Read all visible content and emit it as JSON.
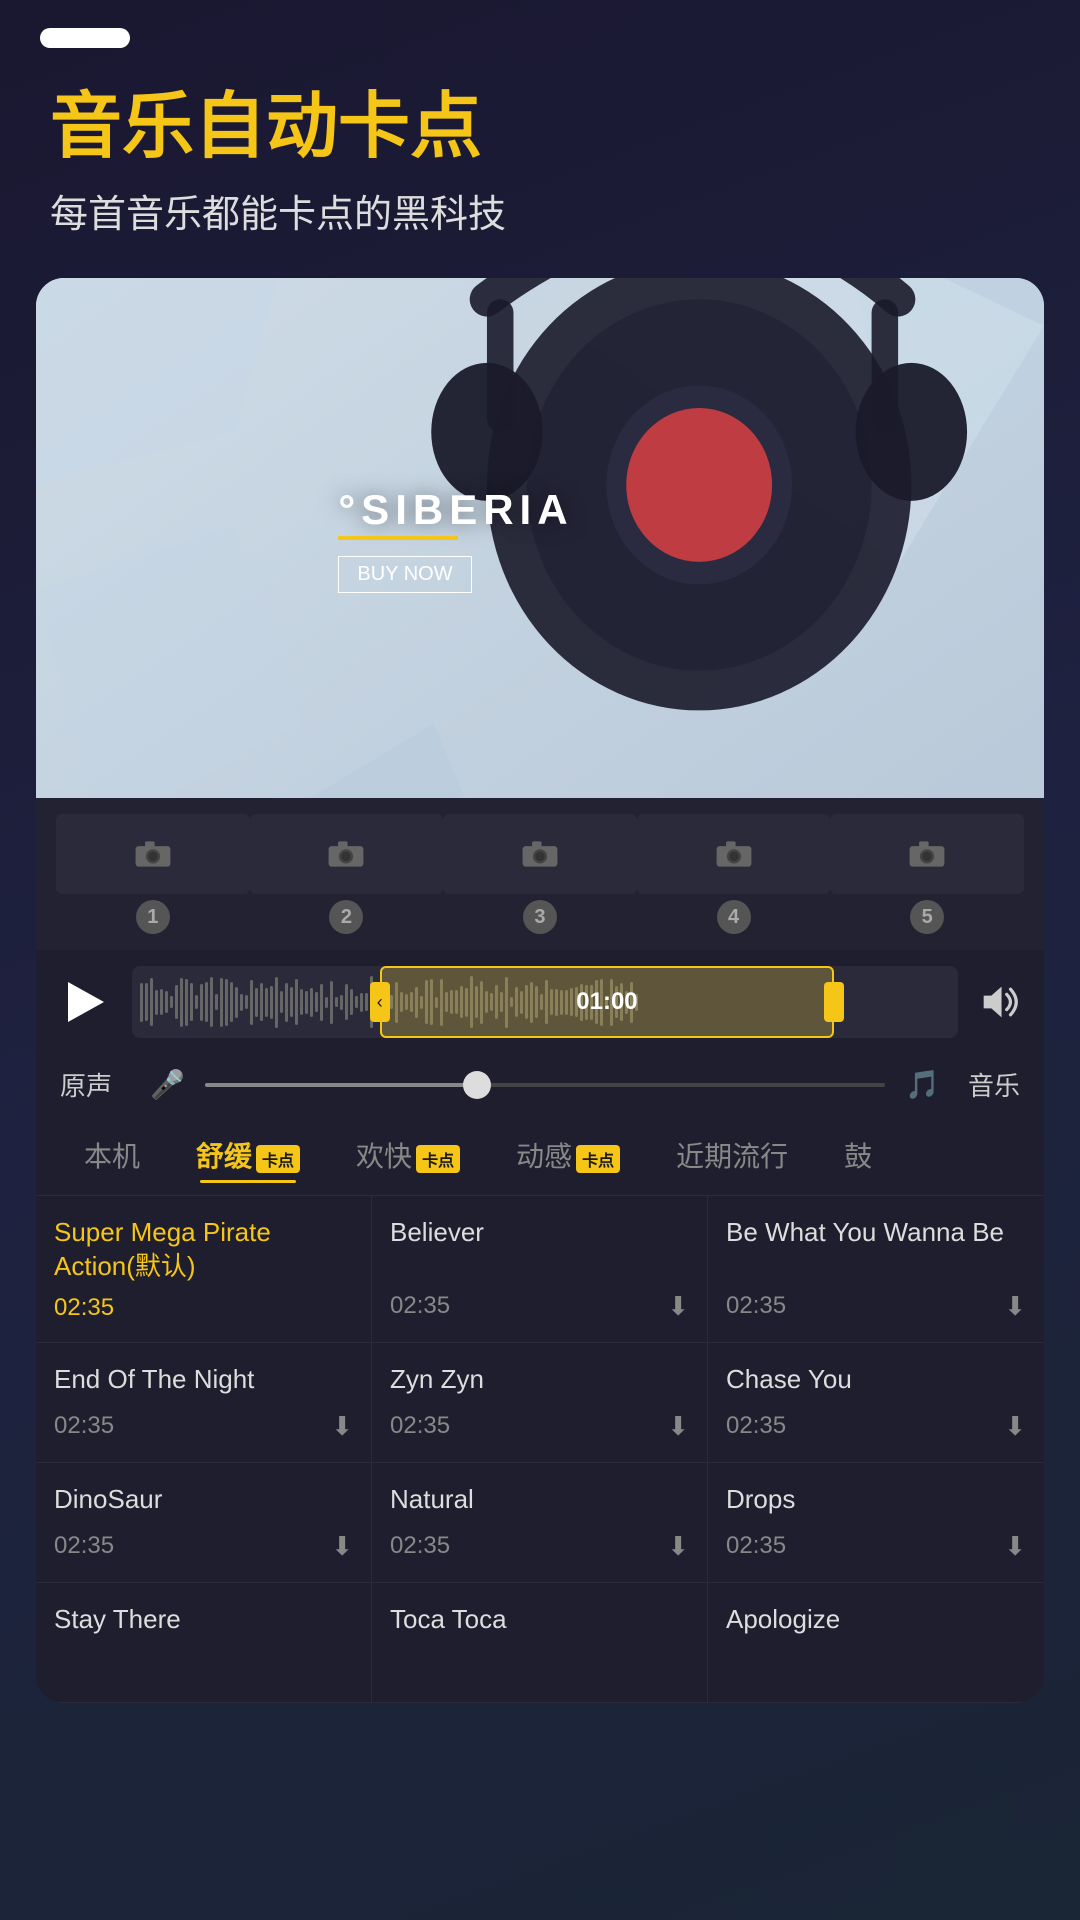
{
  "statusBar": {
    "pill": ""
  },
  "header": {
    "title": "音乐自动卡点",
    "subtitle": "每首音乐都能卡点的黑科技"
  },
  "videoPreview": {
    "brand": "°SIBERIA",
    "buyNow": "BUY NOW"
  },
  "waveform": {
    "time": "01:00"
  },
  "vocalSlider": {
    "leftLabel": "原声",
    "rightLabel": "音乐"
  },
  "tabs": [
    {
      "label": "本机",
      "badge": false,
      "active": false
    },
    {
      "label": "舒缓",
      "badge": true,
      "badgeText": "卡点",
      "active": true
    },
    {
      "label": "欢快",
      "badge": true,
      "badgeText": "卡点",
      "active": false
    },
    {
      "label": "动感",
      "badge": true,
      "badgeText": "卡点",
      "active": false
    },
    {
      "label": "近期流行",
      "badge": false,
      "active": false
    },
    {
      "label": "鼓",
      "badge": false,
      "active": false
    }
  ],
  "songs": [
    {
      "name": "Super Mega Pirate Action(默认)",
      "time": "02:35",
      "highlight": true,
      "download": false
    },
    {
      "name": "Believer",
      "time": "02:35",
      "highlight": false,
      "download": true
    },
    {
      "name": "Be What You Wanna Be",
      "time": "02:35",
      "highlight": false,
      "download": true
    },
    {
      "name": "End Of The Night",
      "time": "02:35",
      "highlight": false,
      "download": true
    },
    {
      "name": "Zyn Zyn",
      "time": "02:35",
      "highlight": false,
      "download": true
    },
    {
      "name": "Chase You",
      "time": "02:35",
      "highlight": false,
      "download": true
    },
    {
      "name": "DinoSaur",
      "time": "02:35",
      "highlight": false,
      "download": true
    },
    {
      "name": "Natural",
      "time": "02:35",
      "highlight": false,
      "download": true
    },
    {
      "name": "Drops",
      "time": "02:35",
      "highlight": false,
      "download": true
    },
    {
      "name": "Stay There",
      "time": "",
      "highlight": false,
      "download": false
    },
    {
      "name": "Toca Toca",
      "time": "",
      "highlight": false,
      "download": false
    },
    {
      "name": "Apologize",
      "time": "",
      "highlight": false,
      "download": false
    }
  ],
  "filmstrip": {
    "slots": [
      "1",
      "2",
      "3",
      "4",
      "5"
    ]
  }
}
